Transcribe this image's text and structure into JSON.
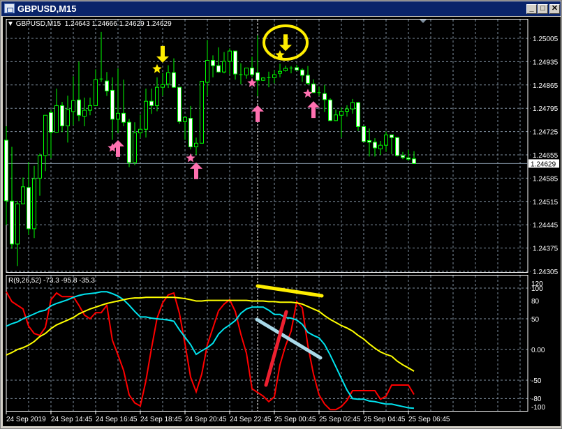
{
  "window": {
    "title": "GBPUSD,M15",
    "minimize_label": "_",
    "maximize_label": "□",
    "close_label": "✕"
  },
  "chart": {
    "header": {
      "arrow": "▼",
      "symbol": "GBPUSD,M15",
      "ohlc": "1.24643 1.24666 1.24629 1.24629"
    },
    "current_price": "1.24629",
    "price_ticks": [
      "1.25005",
      "1.24935",
      "1.24865",
      "1.24795",
      "1.24725",
      "1.24655",
      "1.24585",
      "1.24515",
      "1.24445",
      "1.24375",
      "1.24305"
    ],
    "time_ticks": [
      "24 Sep 2019",
      "24 Sep 14:45",
      "24 Sep 16:45",
      "24 Sep 18:45",
      "24 Sep 20:45",
      "24 Sep 22:45",
      "25 Sep 00:45",
      "25 Sep 02:45",
      "25 Sep 04:45",
      "25 Sep 06:45"
    ],
    "colors": {
      "background": "#000000",
      "candle_outline": "#00ff00",
      "bear_body": "#ffffff",
      "bull_body": "#000000",
      "grid": "#8090a0",
      "buy_signal": "#ff70b0",
      "sell_signal": "#ffee00"
    },
    "candles_ohlc": [
      [
        1.24699,
        1.24741,
        1.24444,
        1.24517
      ],
      [
        1.24516,
        1.24679,
        1.24373,
        1.24387
      ],
      [
        1.24387,
        1.24517,
        1.24321,
        1.24508
      ],
      [
        1.24508,
        1.24587,
        1.24508,
        1.24559
      ],
      [
        1.24557,
        1.24634,
        1.24415,
        1.24433
      ],
      [
        1.24433,
        1.24622,
        1.24405,
        1.24583
      ],
      [
        1.24585,
        1.24659,
        1.24532,
        1.24653
      ],
      [
        1.24653,
        1.24774,
        1.24606,
        1.24774
      ],
      [
        1.24782,
        1.2479,
        1.24645,
        1.24723
      ],
      [
        1.24723,
        1.24854,
        1.24723,
        1.24803
      ],
      [
        1.24803,
        1.24814,
        1.24723,
        1.24742
      ],
      [
        1.24742,
        1.24833,
        1.24692,
        1.24791
      ],
      [
        1.24785,
        1.24891,
        1.24744,
        1.24818
      ],
      [
        1.2482,
        1.24935,
        1.24756,
        1.24774
      ],
      [
        1.24771,
        1.24827,
        1.24741,
        1.24789
      ],
      [
        1.24789,
        1.24827,
        1.24774,
        1.24803
      ],
      [
        1.24803,
        1.24912,
        1.24803,
        1.24881
      ],
      [
        1.24883,
        1.25024,
        1.24874,
        1.24883
      ],
      [
        1.24877,
        1.24904,
        1.24832,
        1.24847
      ],
      [
        1.24849,
        1.24888,
        1.247,
        1.24762
      ],
      [
        1.24762,
        1.24915,
        1.2472,
        1.2478
      ],
      [
        1.2478,
        1.24881,
        1.24741,
        1.24753
      ],
      [
        1.24753,
        1.24763,
        1.24618,
        1.24632
      ],
      [
        1.24632,
        1.24753,
        1.24624,
        1.24721
      ],
      [
        1.24721,
        1.24776,
        1.24706,
        1.24732
      ],
      [
        1.24732,
        1.24854,
        1.24707,
        1.24816
      ],
      [
        1.24816,
        1.24854,
        1.24778,
        1.24803
      ],
      [
        1.24803,
        1.24888,
        1.24786,
        1.24858
      ],
      [
        1.24858,
        1.24901,
        1.24832,
        1.24866
      ],
      [
        1.24868,
        1.24924,
        1.24856,
        1.24902
      ],
      [
        1.24902,
        1.24945,
        1.24856,
        1.24858
      ],
      [
        1.24858,
        1.24858,
        1.24748,
        1.24755
      ],
      [
        1.24755,
        1.24768,
        1.247,
        1.24768
      ],
      [
        1.24765,
        1.24802,
        1.24671,
        1.24679
      ],
      [
        1.24679,
        1.24707,
        1.24655,
        1.2469
      ],
      [
        1.2469,
        1.24876,
        1.2469,
        1.24876
      ],
      [
        1.24873,
        1.25,
        1.24832,
        1.24939
      ],
      [
        1.24939,
        1.24954,
        1.24888,
        1.24923
      ],
      [
        1.24923,
        1.24978,
        1.24902,
        1.24904
      ],
      [
        1.24904,
        1.24964,
        1.249,
        1.24936
      ],
      [
        1.24936,
        1.24975,
        1.24898,
        1.24967
      ],
      [
        1.24967,
        1.24967,
        1.24881,
        1.24898
      ],
      [
        1.24896,
        1.2493,
        1.24867,
        1.24895
      ],
      [
        1.24895,
        1.24916,
        1.24884,
        1.24916
      ],
      [
        1.24916,
        1.2495,
        1.24888,
        1.24896
      ],
      [
        1.24902,
        1.25014,
        1.24831,
        1.24879
      ],
      [
        1.24879,
        1.24888,
        1.24877,
        1.24886
      ],
      [
        1.24886,
        1.24905,
        1.24858,
        1.24887
      ],
      [
        1.24887,
        1.24909,
        1.2487,
        1.24896
      ],
      [
        1.249,
        1.24929,
        1.24888,
        1.24906
      ],
      [
        1.24908,
        1.24923,
        1.24905,
        1.24915
      ],
      [
        1.24915,
        1.24922,
        1.249,
        1.24916
      ],
      [
        1.24917,
        1.24926,
        1.24909,
        1.2491
      ],
      [
        1.2491,
        1.24915,
        1.24874,
        1.24894
      ],
      [
        1.24894,
        1.24922,
        1.24865,
        1.2487
      ],
      [
        1.24868,
        1.24882,
        1.24842,
        1.24842
      ],
      [
        1.24842,
        1.2486,
        1.24832,
        1.24839
      ],
      [
        1.24839,
        1.24865,
        1.24784,
        1.24821
      ],
      [
        1.2482,
        1.24825,
        1.24756,
        1.24758
      ],
      [
        1.24758,
        1.24791,
        1.24756,
        1.24775
      ],
      [
        1.24774,
        1.24798,
        1.24707,
        1.24786
      ],
      [
        1.24786,
        1.24804,
        1.2477,
        1.24793
      ],
      [
        1.24793,
        1.24823,
        1.24779,
        1.24812
      ],
      [
        1.24812,
        1.24814,
        1.24727,
        1.2474
      ],
      [
        1.2474,
        1.2474,
        1.24695,
        1.24695
      ],
      [
        1.24698,
        1.24734,
        1.2465,
        1.24693
      ],
      [
        1.24693,
        1.24705,
        1.2465,
        1.24676
      ],
      [
        1.24673,
        1.24697,
        1.24655,
        1.24684
      ],
      [
        1.24684,
        1.24725,
        1.24664,
        1.24715
      ],
      [
        1.24715,
        1.24715,
        1.24657,
        1.24707
      ],
      [
        1.24707,
        1.24707,
        1.2465,
        1.24653
      ],
      [
        1.24653,
        1.24664,
        1.24642,
        1.24647
      ],
      [
        1.24646,
        1.2467,
        1.24637,
        1.24642
      ],
      [
        1.24643,
        1.24666,
        1.24629,
        1.24629
      ]
    ],
    "signals": [
      {
        "type": "sell-arrow",
        "candle": 28,
        "price": 1.24957
      },
      {
        "type": "sell-star",
        "candle": 27,
        "price": 1.24913
      },
      {
        "type": "sell-arrow",
        "candle": 50,
        "price": 1.24992
      },
      {
        "type": "sell-star",
        "candle": 49,
        "price": 1.24955
      },
      {
        "type": "buy-star",
        "candle": 19,
        "price": 1.24676
      },
      {
        "type": "buy-arrow",
        "candle": 20,
        "price": 1.24674
      },
      {
        "type": "buy-star",
        "candle": 33,
        "price": 1.24645
      },
      {
        "type": "buy-arrow",
        "candle": 34,
        "price": 1.24607
      },
      {
        "type": "buy-star",
        "candle": 44,
        "price": 1.24871
      },
      {
        "type": "buy-arrow",
        "candle": 45,
        "price": 1.24779
      },
      {
        "type": "buy-star",
        "candle": 54,
        "price": 1.24839
      },
      {
        "type": "buy-arrow",
        "candle": 55,
        "price": 1.24791
      }
    ]
  },
  "indicator": {
    "header": "R(9,26,52) -73.3 -95.8 -35.3",
    "level_ticks": [
      "120",
      "100",
      "80",
      "50",
      "0.00",
      "-50",
      "-80",
      "-100"
    ],
    "series": [
      {
        "period": 9,
        "color": "#ff0000",
        "values": [
          94,
          78,
          72,
          66,
          38,
          26,
          23,
          36,
          81,
          92,
          86,
          86,
          86,
          72,
          56,
          50,
          60,
          60,
          72,
          15,
          -9,
          -34,
          -74,
          -87,
          -92,
          -51,
          2,
          51,
          76,
          89,
          92,
          59,
          9,
          -45,
          -69,
          -40,
          8,
          35,
          63,
          74,
          81,
          62,
          25,
          -6,
          -64,
          -70,
          -76,
          -85,
          -77,
          -25,
          6,
          30,
          78,
          68,
          6,
          -40,
          -74,
          -89,
          -98,
          -98,
          -93,
          -83,
          -67,
          -67,
          -67,
          -67,
          -67,
          -81,
          -76,
          -58,
          -58,
          -58,
          -58,
          -73.3
        ]
      },
      {
        "period": 26,
        "color": "#00e5f0",
        "values": [
          38,
          42,
          45,
          50,
          54,
          58,
          62,
          64,
          71,
          75,
          78,
          81,
          85,
          88,
          90,
          91,
          92,
          94,
          94,
          91,
          87,
          81,
          72,
          62,
          53,
          53,
          51,
          50,
          49,
          48,
          46,
          32,
          20,
          8,
          -8,
          -2,
          3,
          10,
          25,
          34,
          40,
          47,
          59,
          66,
          69,
          69,
          69,
          64,
          57,
          57,
          52,
          51,
          48,
          41,
          28,
          23,
          19,
          8,
          -9,
          -28,
          -47,
          -66,
          -80,
          -81,
          -81,
          -84,
          -85,
          -87,
          -89,
          -89,
          -91,
          -93,
          -95,
          -95.8
        ]
      },
      {
        "period": 52,
        "color": "#ffff00",
        "values": [
          -9,
          -5,
          0,
          3,
          7,
          13,
          21,
          26,
          34,
          40,
          44,
          48,
          52,
          58,
          62,
          66,
          69,
          72,
          75,
          77,
          79,
          81,
          83,
          84,
          84,
          85,
          85,
          85,
          85,
          85,
          85,
          84,
          83,
          81,
          79,
          79,
          80,
          80,
          80,
          80,
          80,
          80,
          80,
          80,
          79,
          79,
          79,
          78,
          78,
          77,
          77,
          77,
          76,
          74,
          70,
          66,
          62,
          55,
          49,
          44,
          39,
          35,
          30,
          23,
          17,
          9,
          2,
          -4,
          -8,
          -11,
          -19,
          -25,
          -30,
          -35.3
        ]
      }
    ],
    "annotation_colors": {
      "top_trendline": "#ffee00",
      "mid_trendline": "#a8d8e8",
      "red_trendline": "#ee2030",
      "highlight_ellipse": "#ffee00"
    }
  }
}
